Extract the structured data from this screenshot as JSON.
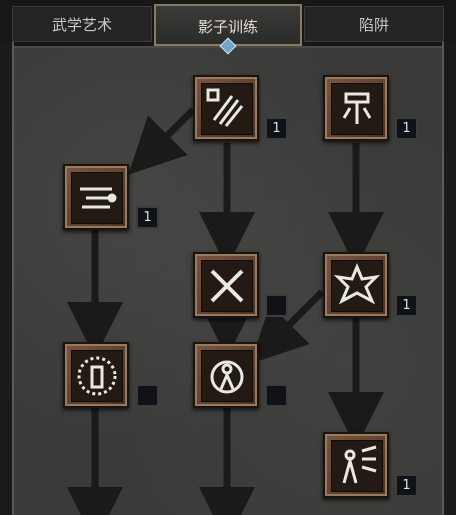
{
  "tabs": [
    {
      "label": "武学艺术",
      "active": false
    },
    {
      "label": "影子训练",
      "active": true
    },
    {
      "label": "陷阱",
      "active": false
    }
  ],
  "skills": [
    {
      "icon": "claw-strike-icon",
      "rank": "1"
    },
    {
      "icon": "fist-shield-icon",
      "rank": "1"
    },
    {
      "icon": "speed-dash-icon",
      "rank": "1"
    },
    {
      "icon": "crossed-blades-icon",
      "rank": ""
    },
    {
      "icon": "burst-star-icon",
      "rank": "1"
    },
    {
      "icon": "aura-figure-icon",
      "rank": ""
    },
    {
      "icon": "shadow-figure-icon",
      "rank": ""
    },
    {
      "icon": "radiant-figure-icon",
      "rank": "1"
    }
  ],
  "colors": {
    "accent": "#6fa6c8",
    "frame": "#8a7a5d",
    "rank_text": "#cfe3f1"
  }
}
